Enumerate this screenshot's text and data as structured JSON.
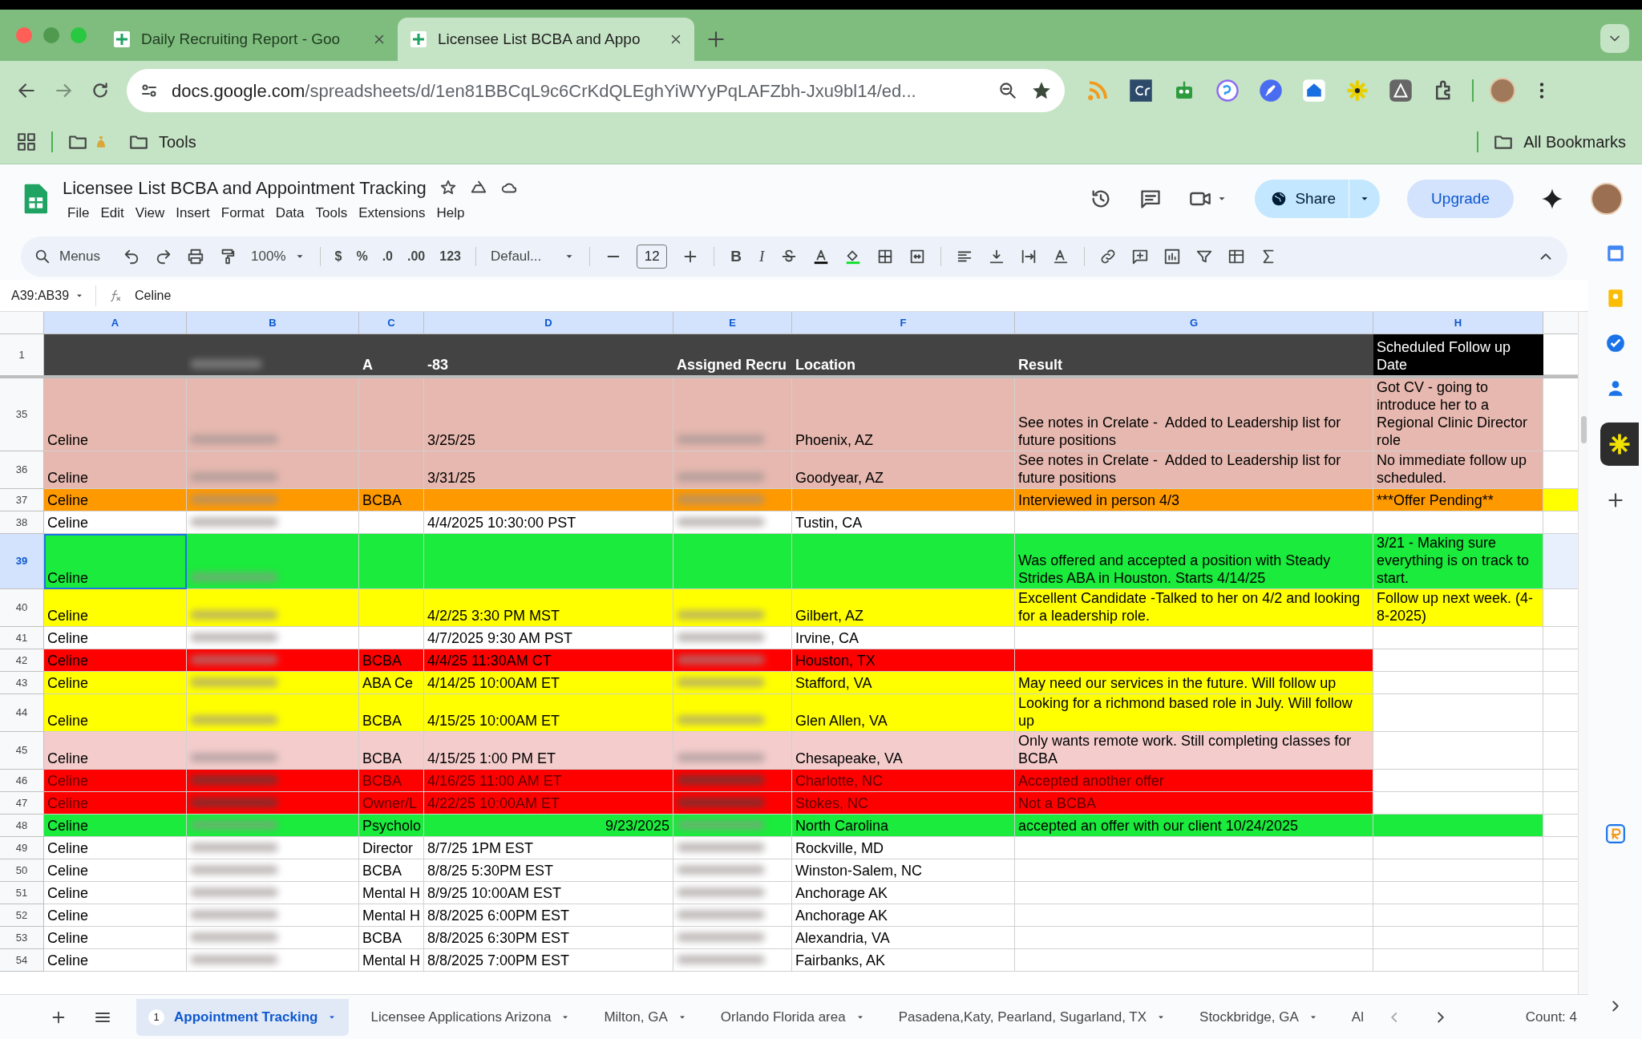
{
  "browser": {
    "tabs": [
      {
        "title": "Daily Recruiting Report - Goo",
        "selected": false
      },
      {
        "title": "Licensee List BCBA and Appo",
        "selected": true
      }
    ],
    "url_host": "docs.google.com",
    "url_path": "/spreadsheets/d/1en81BBCqL9c6CrKdQLEghYiWYyPqLAFZbh-Jxu9bl14/ed...",
    "bookmarks": [
      "Tools"
    ],
    "all_bookmarks": "All Bookmarks"
  },
  "document": {
    "title": "Licensee List BCBA and Appointment Tracking",
    "menu": [
      "File",
      "Edit",
      "View",
      "Insert",
      "Format",
      "Data",
      "Tools",
      "Extensions",
      "Help"
    ],
    "share": "Share",
    "upgrade": "Upgrade"
  },
  "toolbar": {
    "search": "Menus",
    "zoom": "100%",
    "number_formats": [
      "$",
      "%",
      ".0",
      ".00",
      "123"
    ],
    "font": "Defaul...",
    "font_size": "12",
    "text_styles": [
      "B",
      "I"
    ]
  },
  "formula_bar": {
    "name_box": "A39:AB39",
    "value": "Celine"
  },
  "columns": [
    {
      "letter": "A",
      "selected": true
    },
    {
      "letter": "B",
      "selected": true
    },
    {
      "letter": "C",
      "selected": true
    },
    {
      "letter": "D",
      "selected": true
    },
    {
      "letter": "E",
      "selected": true
    },
    {
      "letter": "F",
      "selected": true
    },
    {
      "letter": "G",
      "selected": true
    },
    {
      "letter": "H",
      "selected": true
    }
  ],
  "header_row": {
    "number": "1",
    "cells": [
      {
        "kind": "empty"
      },
      {
        "kind": "redacted"
      },
      {
        "kind": "text",
        "text": "A"
      },
      {
        "kind": "text",
        "text": "-83"
      },
      {
        "kind": "text",
        "text": "Assigned Recru"
      },
      {
        "kind": "text",
        "text": "Location"
      },
      {
        "kind": "text",
        "text": "Result"
      },
      {
        "kind": "text",
        "text": "Scheduled Follow up Date"
      }
    ]
  },
  "rows": [
    {
      "number": "35",
      "selected": false,
      "muted": false,
      "color": "#e6b8af",
      "cells": [
        {
          "kind": "text",
          "text": "Celine"
        },
        {
          "kind": "redacted"
        },
        {
          "kind": "empty"
        },
        {
          "kind": "text",
          "text": "3/25/25"
        },
        {
          "kind": "redacted"
        },
        {
          "kind": "text",
          "text": "Phoenix, AZ"
        },
        {
          "kind": "text",
          "text": "See notes in Crelate -  Added to Leadership list for future positions"
        },
        {
          "kind": "text",
          "text": "Got CV - going to introduce her to a Regional Clinic Director role",
          "color": "#e6b8af"
        }
      ]
    },
    {
      "number": "36",
      "selected": false,
      "muted": false,
      "color": "#e6b8af",
      "cells": [
        {
          "kind": "text",
          "text": "Celine"
        },
        {
          "kind": "redacted"
        },
        {
          "kind": "empty"
        },
        {
          "kind": "text",
          "text": "3/31/25"
        },
        {
          "kind": "redacted"
        },
        {
          "kind": "text",
          "text": "Goodyear, AZ"
        },
        {
          "kind": "text",
          "text": "See notes in Crelate -  Added to Leadership list for future positions"
        },
        {
          "kind": "text",
          "text": "No immediate follow up scheduled.",
          "color": "#e6b8af"
        }
      ]
    },
    {
      "number": "37",
      "selected": false,
      "muted": false,
      "color": "#ff9900",
      "cells": [
        {
          "kind": "text",
          "text": "Celine"
        },
        {
          "kind": "redacted"
        },
        {
          "kind": "text",
          "text": "BCBA"
        },
        {
          "kind": "empty"
        },
        {
          "kind": "redacted"
        },
        {
          "kind": "empty"
        },
        {
          "kind": "text",
          "text": "Interviewed in person 4/3"
        },
        {
          "kind": "text",
          "text": "***Offer Pending**",
          "color": "#ff9900"
        },
        {
          "kind": "empty",
          "color": "#ffff00"
        }
      ]
    },
    {
      "number": "38",
      "selected": false,
      "muted": false,
      "color": "#ffffff",
      "cells": [
        {
          "kind": "text",
          "text": "Celine"
        },
        {
          "kind": "redacted"
        },
        {
          "kind": "empty"
        },
        {
          "kind": "text",
          "text": "4/4/2025 10:30:00 PST"
        },
        {
          "kind": "redacted"
        },
        {
          "kind": "text",
          "text": "Tustin, CA"
        },
        {
          "kind": "empty"
        },
        {
          "kind": "empty"
        }
      ]
    },
    {
      "number": "39",
      "selected": true,
      "muted": false,
      "color": "#1aeb3c",
      "cells": [
        {
          "kind": "text",
          "text": "Celine"
        },
        {
          "kind": "redacted"
        },
        {
          "kind": "empty"
        },
        {
          "kind": "empty"
        },
        {
          "kind": "empty"
        },
        {
          "kind": "empty"
        },
        {
          "kind": "text",
          "text": "Was offered and accepted a position with Steady Strides ABA in Houston. Starts 4/14/25"
        },
        {
          "kind": "text",
          "text": "3/21 - Making sure everything is on track to start.",
          "color": "#1aeb3c"
        }
      ]
    },
    {
      "number": "40",
      "selected": false,
      "muted": false,
      "color": "#ffff00",
      "cells": [
        {
          "kind": "text",
          "text": "Celine"
        },
        {
          "kind": "redacted"
        },
        {
          "kind": "empty"
        },
        {
          "kind": "text",
          "text": "4/2/25 3:30 PM MST"
        },
        {
          "kind": "redacted"
        },
        {
          "kind": "text",
          "text": "Gilbert, AZ"
        },
        {
          "kind": "text",
          "text": "Excellent Candidate -Talked to her on 4/2 and looking for a leadership role."
        },
        {
          "kind": "text",
          "text": "Follow up next week. (4-8-2025)",
          "color": "#ffff00"
        }
      ]
    },
    {
      "number": "41",
      "selected": false,
      "muted": false,
      "color": "#ffffff",
      "cells": [
        {
          "kind": "text",
          "text": "Celine"
        },
        {
          "kind": "redacted"
        },
        {
          "kind": "empty"
        },
        {
          "kind": "text",
          "text": "4/7/2025 9:30 AM PST"
        },
        {
          "kind": "redacted"
        },
        {
          "kind": "text",
          "text": "Irvine, CA"
        },
        {
          "kind": "empty"
        },
        {
          "kind": "empty"
        }
      ]
    },
    {
      "number": "42",
      "selected": false,
      "muted": false,
      "color": "#ff0000",
      "cells": [
        {
          "kind": "text",
          "text": "Celine"
        },
        {
          "kind": "redacted"
        },
        {
          "kind": "text",
          "text": "BCBA"
        },
        {
          "kind": "text",
          "text": "4/4/25 11:30AM CT"
        },
        {
          "kind": "redacted"
        },
        {
          "kind": "text",
          "text": "Houston, TX"
        },
        {
          "kind": "empty"
        },
        {
          "kind": "empty"
        }
      ]
    },
    {
      "number": "43",
      "selected": false,
      "muted": false,
      "color": "#ffff00",
      "cells": [
        {
          "kind": "text",
          "text": "Celine"
        },
        {
          "kind": "redacted"
        },
        {
          "kind": "text",
          "text": "ABA Ce"
        },
        {
          "kind": "text",
          "text": "4/14/25 10:00AM ET"
        },
        {
          "kind": "redacted"
        },
        {
          "kind": "text",
          "text": "Stafford, VA"
        },
        {
          "kind": "text",
          "text": "May need our services in the future. Will follow up"
        },
        {
          "kind": "empty"
        }
      ]
    },
    {
      "number": "44",
      "selected": false,
      "muted": false,
      "color": "#ffff00",
      "cells": [
        {
          "kind": "text",
          "text": "Celine"
        },
        {
          "kind": "redacted"
        },
        {
          "kind": "text",
          "text": "BCBA"
        },
        {
          "kind": "text",
          "text": "4/15/25 10:00AM ET"
        },
        {
          "kind": "redacted"
        },
        {
          "kind": "text",
          "text": "Glen Allen, VA"
        },
        {
          "kind": "text",
          "text": "Looking for a richmond based role in July. Will follow up"
        },
        {
          "kind": "empty"
        }
      ]
    },
    {
      "number": "45",
      "selected": false,
      "muted": false,
      "color": "#f4cccc",
      "cells": [
        {
          "kind": "text",
          "text": "Celine"
        },
        {
          "kind": "redacted"
        },
        {
          "kind": "text",
          "text": "BCBA"
        },
        {
          "kind": "text",
          "text": "4/15/25 1:00 PM ET"
        },
        {
          "kind": "redacted"
        },
        {
          "kind": "text",
          "text": "Chesapeake, VA"
        },
        {
          "kind": "text",
          "text": "Only wants remote work. Still completing classes for BCBA"
        },
        {
          "kind": "empty"
        }
      ]
    },
    {
      "number": "46",
      "selected": false,
      "muted": true,
      "color": "#ff0000",
      "cells": [
        {
          "kind": "text",
          "text": "Celine"
        },
        {
          "kind": "redacted"
        },
        {
          "kind": "text",
          "text": "BCBA"
        },
        {
          "kind": "text",
          "text": "4/16/25 11:00 AM ET"
        },
        {
          "kind": "redacted"
        },
        {
          "kind": "text",
          "text": "Charlotte, NC"
        },
        {
          "kind": "text",
          "text": "Accepted another offer"
        },
        {
          "kind": "empty"
        }
      ]
    },
    {
      "number": "47",
      "selected": false,
      "muted": true,
      "color": "#ff0000",
      "cells": [
        {
          "kind": "text",
          "text": "Celine"
        },
        {
          "kind": "redacted"
        },
        {
          "kind": "text",
          "text": "Owner/L"
        },
        {
          "kind": "text",
          "text": "4/22/25 10:00AM ET"
        },
        {
          "kind": "redacted"
        },
        {
          "kind": "text",
          "text": "Stokes, NC"
        },
        {
          "kind": "text",
          "text": "Not a BCBA"
        },
        {
          "kind": "empty"
        }
      ]
    },
    {
      "number": "48",
      "selected": false,
      "muted": false,
      "color": "#1aeb3c",
      "cells": [
        {
          "kind": "text",
          "text": "Celine"
        },
        {
          "kind": "redacted"
        },
        {
          "kind": "text",
          "text": "Psycholo"
        },
        {
          "kind": "number",
          "text": "9/23/2025"
        },
        {
          "kind": "redacted"
        },
        {
          "kind": "text",
          "text": "North Carolina"
        },
        {
          "kind": "text",
          "text": "accepted an offer with our client 10/24/2025"
        },
        {
          "kind": "empty",
          "color": "#1aeb3c"
        }
      ]
    },
    {
      "number": "49",
      "selected": false,
      "muted": false,
      "color": "#ffffff",
      "cells": [
        {
          "kind": "text",
          "text": "Celine"
        },
        {
          "kind": "redacted"
        },
        {
          "kind": "text",
          "text": "Director"
        },
        {
          "kind": "text",
          "text": "8/7/25 1PM EST"
        },
        {
          "kind": "redacted"
        },
        {
          "kind": "text",
          "text": "Rockville, MD"
        },
        {
          "kind": "empty"
        },
        {
          "kind": "empty"
        }
      ]
    },
    {
      "number": "50",
      "selected": false,
      "muted": false,
      "color": "#ffffff",
      "cells": [
        {
          "kind": "text",
          "text": "Celine"
        },
        {
          "kind": "redacted"
        },
        {
          "kind": "text",
          "text": "BCBA"
        },
        {
          "kind": "text",
          "text": "8/8/25 5:30PM EST"
        },
        {
          "kind": "redacted"
        },
        {
          "kind": "text",
          "text": "Winston-Salem, NC"
        },
        {
          "kind": "empty"
        },
        {
          "kind": "empty"
        }
      ]
    },
    {
      "number": "51",
      "selected": false,
      "muted": false,
      "color": "#ffffff",
      "cells": [
        {
          "kind": "text",
          "text": "Celine"
        },
        {
          "kind": "redacted"
        },
        {
          "kind": "text",
          "text": "Mental H"
        },
        {
          "kind": "text",
          "text": "8/9/25 10:00AM EST"
        },
        {
          "kind": "redacted"
        },
        {
          "kind": "text",
          "text": "Anchorage AK"
        },
        {
          "kind": "empty"
        },
        {
          "kind": "empty"
        }
      ]
    },
    {
      "number": "52",
      "selected": false,
      "muted": false,
      "color": "#ffffff",
      "cells": [
        {
          "kind": "text",
          "text": "Celine"
        },
        {
          "kind": "redacted"
        },
        {
          "kind": "text",
          "text": "Mental H"
        },
        {
          "kind": "text",
          "text": "8/8/2025 6:00PM EST"
        },
        {
          "kind": "redacted"
        },
        {
          "kind": "text",
          "text": "Anchorage AK"
        },
        {
          "kind": "empty"
        },
        {
          "kind": "empty"
        }
      ]
    },
    {
      "number": "53",
      "selected": false,
      "muted": false,
      "color": "#ffffff",
      "cells": [
        {
          "kind": "text",
          "text": "Celine"
        },
        {
          "kind": "redacted"
        },
        {
          "kind": "text",
          "text": "BCBA"
        },
        {
          "kind": "text",
          "text": "8/8/2025 6:30PM EST"
        },
        {
          "kind": "redacted"
        },
        {
          "kind": "text",
          "text": "Alexandria, VA"
        },
        {
          "kind": "empty"
        },
        {
          "kind": "empty"
        }
      ]
    },
    {
      "number": "54",
      "selected": false,
      "muted": false,
      "color": "#ffffff",
      "cells": [
        {
          "kind": "text",
          "text": "Celine"
        },
        {
          "kind": "redacted"
        },
        {
          "kind": "text",
          "text": "Mental H"
        },
        {
          "kind": "text",
          "text": "8/8/2025 7:00PM EST"
        },
        {
          "kind": "redacted"
        },
        {
          "kind": "text",
          "text": "Fairbanks, AK"
        },
        {
          "kind": "empty"
        },
        {
          "kind": "empty"
        }
      ]
    }
  ],
  "sheet_tabs": [
    {
      "label": "Appointment Tracking",
      "badge": "1",
      "selected": true,
      "cut": false
    },
    {
      "label": "Licensee Applications Arizona",
      "selected": false,
      "cut": false
    },
    {
      "label": "Milton, GA",
      "selected": false,
      "cut": false
    },
    {
      "label": "Orlando Florida area",
      "selected": false,
      "cut": false
    },
    {
      "label": "Pasadena,Katy, Pearland, Sugarland, TX",
      "selected": false,
      "cut": false
    },
    {
      "label": "Stockbridge, GA",
      "selected": false,
      "cut": false
    },
    {
      "label": "Al",
      "selected": false,
      "cut": true
    }
  ],
  "status": "Count: 4"
}
